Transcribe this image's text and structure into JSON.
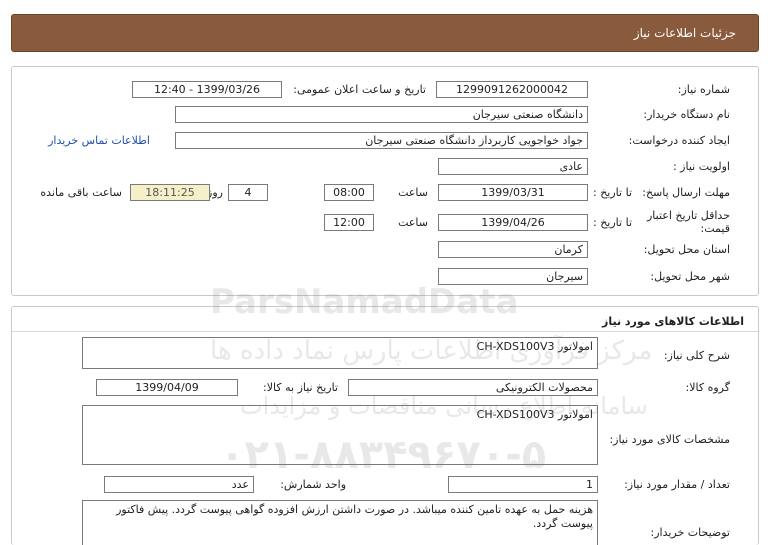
{
  "page": {
    "title": "جزئیات اطلاعات نیاز"
  },
  "need_info": {
    "need_number_label": "شماره نیاز:",
    "need_number": "1299091262000042",
    "announce_label": "تاریخ و ساعت اعلان عمومی:",
    "announce_value": "1399/03/26 - 12:40",
    "buyer_org_label": "نام دستگاه خریدار:",
    "buyer_org": "دانشگاه صنعتی سیرجان",
    "requester_label": "ایجاد کننده درخواست:",
    "requester": "جواد خواجویی کاربرداز دانشگاه صنعتی سیرجان",
    "contact_link": "اطلاعات تماس خریدار",
    "priority_label": "اولویت نیاز :",
    "priority": "عادی",
    "deadline_label": "مهلت ارسال پاسخ:",
    "until_date_label": "تا تاریخ :",
    "deadline_date": "1399/03/31",
    "time_label": "ساعت",
    "deadline_time": "08:00",
    "days_value": "4",
    "days_label": "روز و",
    "remaining_time": "18:11:25",
    "remaining_label": "ساعت باقی مانده",
    "price_validity_label": "حداقل تاریخ اعتبار قیمت:",
    "price_validity_date": "1399/04/26",
    "price_validity_time": "12:00",
    "province_label": "استان محل تحویل:",
    "province": "کرمان",
    "city_label": "شهر محل تحویل:",
    "city": "سیرجان"
  },
  "goods_info": {
    "section_title": "اطلاعات کالاهای مورد نیاز",
    "summary_label": "شرح کلی نیاز:",
    "summary": "امولاتور CH-XDS100V3",
    "group_label": "گروه کالا:",
    "group": "محصولات الکترونیکی",
    "need_date_label": "تاریخ نیاز به کالا:",
    "need_date": "1399/04/09",
    "specs_label": "مشخصات کالای مورد نیاز:",
    "specs": "امولاتور CH-XDS100V3",
    "quantity_label": "تعداد / مقدار مورد نیاز:",
    "quantity": "1",
    "unit_label": "واحد شمارش:",
    "unit": "عدد",
    "buyer_notes_label": "توضیحات خریدار:",
    "buyer_notes": "هزینه حمل به عهده تامین کننده میباشد. در صورت داشتن ارزش افزوده گواهی پیوست گردد. پیش فاکتور  پیوست گردد."
  },
  "watermark": {
    "brand": "ParsNamadData",
    "tagline": "مرکز فرآوری اطلاعات پارس نماد داده ها",
    "subline": "سامانه اطلاع رسانی مناقصات و مزایدات",
    "phone": "۰۲۱-۸۸۳۴۹۶۷۰-۵"
  },
  "colors": {
    "titlebar": "#8a5a3c",
    "link": "#1f4fb0",
    "highlight": "#f5f0c8"
  }
}
